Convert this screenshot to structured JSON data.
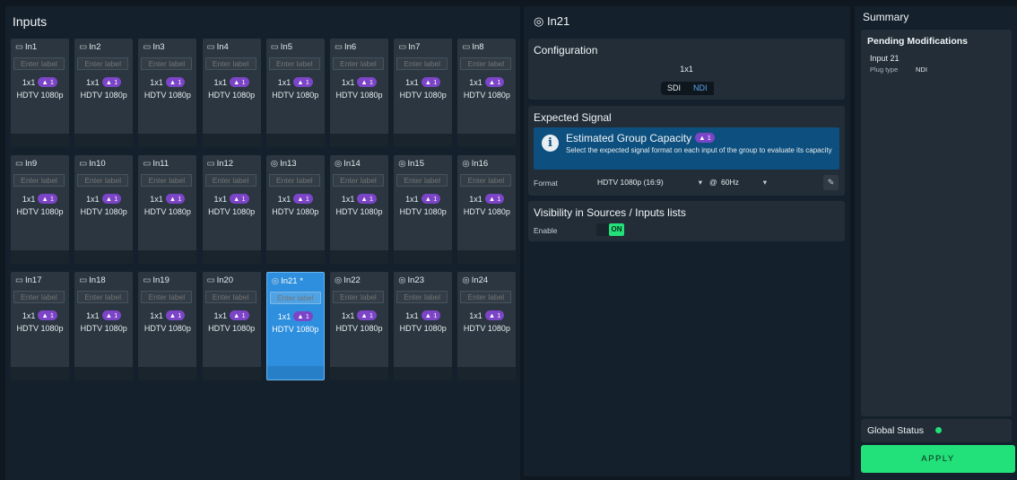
{
  "inputs_panel": {
    "title": "Inputs",
    "label_placeholder": "Enter label",
    "cards": [
      {
        "name": "In1",
        "format": "1x1",
        "badge": "▲ 1",
        "resolution": "HDTV 1080p",
        "icon": "sdi-plug-icon",
        "selected": false
      },
      {
        "name": "In2",
        "format": "1x1",
        "badge": "▲ 1",
        "resolution": "HDTV 1080p",
        "icon": "sdi-plug-icon",
        "selected": false
      },
      {
        "name": "In3",
        "format": "1x1",
        "badge": "▲ 1",
        "resolution": "HDTV 1080p",
        "icon": "sdi-plug-icon",
        "selected": false
      },
      {
        "name": "In4",
        "format": "1x1",
        "badge": "▲ 1",
        "resolution": "HDTV 1080p",
        "icon": "sdi-plug-icon",
        "selected": false
      },
      {
        "name": "In5",
        "format": "1x1",
        "badge": "▲ 1",
        "resolution": "HDTV 1080p",
        "icon": "sdi-plug-icon",
        "selected": false
      },
      {
        "name": "In6",
        "format": "1x1",
        "badge": "▲ 1",
        "resolution": "HDTV 1080p",
        "icon": "sdi-plug-icon",
        "selected": false
      },
      {
        "name": "In7",
        "format": "1x1",
        "badge": "▲ 1",
        "resolution": "HDTV 1080p",
        "icon": "sdi-plug-icon",
        "selected": false
      },
      {
        "name": "In8",
        "format": "1x1",
        "badge": "▲ 1",
        "resolution": "HDTV 1080p",
        "icon": "sdi-plug-icon",
        "selected": false
      },
      {
        "name": "In9",
        "format": "1x1",
        "badge": "▲ 1",
        "resolution": "HDTV 1080p",
        "icon": "sdi-plug-icon",
        "selected": false
      },
      {
        "name": "In10",
        "format": "1x1",
        "badge": "▲ 1",
        "resolution": "HDTV 1080p",
        "icon": "sdi-plug-icon",
        "selected": false
      },
      {
        "name": "In11",
        "format": "1x1",
        "badge": "▲ 1",
        "resolution": "HDTV 1080p",
        "icon": "sdi-plug-icon",
        "selected": false
      },
      {
        "name": "In12",
        "format": "1x1",
        "badge": "▲ 1",
        "resolution": "HDTV 1080p",
        "icon": "sdi-plug-icon",
        "selected": false
      },
      {
        "name": "In13",
        "format": "1x1",
        "badge": "▲ 1",
        "resolution": "HDTV 1080p",
        "icon": "ndi-icon",
        "selected": false
      },
      {
        "name": "In14",
        "format": "1x1",
        "badge": "▲ 1",
        "resolution": "HDTV 1080p",
        "icon": "ndi-icon",
        "selected": false
      },
      {
        "name": "In15",
        "format": "1x1",
        "badge": "▲ 1",
        "resolution": "HDTV 1080p",
        "icon": "ndi-icon",
        "selected": false
      },
      {
        "name": "In16",
        "format": "1x1",
        "badge": "▲ 1",
        "resolution": "HDTV 1080p",
        "icon": "ndi-icon",
        "selected": false
      },
      {
        "name": "In17",
        "format": "1x1",
        "badge": "▲ 1",
        "resolution": "HDTV 1080p",
        "icon": "sdi-plug-icon",
        "selected": false
      },
      {
        "name": "In18",
        "format": "1x1",
        "badge": "▲ 1",
        "resolution": "HDTV 1080p",
        "icon": "sdi-plug-icon",
        "selected": false
      },
      {
        "name": "In19",
        "format": "1x1",
        "badge": "▲ 1",
        "resolution": "HDTV 1080p",
        "icon": "sdi-plug-icon",
        "selected": false
      },
      {
        "name": "In20",
        "format": "1x1",
        "badge": "▲ 1",
        "resolution": "HDTV 1080p",
        "icon": "sdi-plug-icon",
        "selected": false
      },
      {
        "name": "In21 *",
        "format": "1x1",
        "badge": "▲ 1",
        "resolution": "HDTV 1080p",
        "icon": "ndi-icon",
        "selected": true
      },
      {
        "name": "In22",
        "format": "1x1",
        "badge": "▲ 1",
        "resolution": "HDTV 1080p",
        "icon": "ndi-icon",
        "selected": false
      },
      {
        "name": "In23",
        "format": "1x1",
        "badge": "▲ 1",
        "resolution": "HDTV 1080p",
        "icon": "ndi-icon",
        "selected": false
      },
      {
        "name": "In24",
        "format": "1x1",
        "badge": "▲ 1",
        "resolution": "HDTV 1080p",
        "icon": "ndi-icon",
        "selected": false
      }
    ]
  },
  "detail": {
    "title": "In21",
    "title_icon": "ndi-icon",
    "configuration": {
      "title": "Configuration",
      "value": "1x1",
      "options": [
        "SDI",
        "NDI"
      ],
      "selected": "NDI"
    },
    "expected_signal": {
      "title": "Expected Signal",
      "info_title": "Estimated Group Capacity",
      "info_badge": "▲ 1",
      "info_text": "Select the expected signal format on each input of the group to evaluate its capacity",
      "format_label": "Format",
      "format_value": "HDTV 1080p (16:9)",
      "at_label": "@",
      "rate_value": "60Hz"
    },
    "visibility": {
      "title": "Visibility in Sources / Inputs lists",
      "enable_label": "Enable",
      "toggle_state": "ON"
    }
  },
  "summary": {
    "title": "Summary",
    "pending_title": "Pending Modifications",
    "pending_input": "Input 21",
    "plug_type_label": "Plug type",
    "plug_type_value": "NDI",
    "global_status_label": "Global Status",
    "apply_label": "APPLY"
  },
  "colors": {
    "background": "#0f1820",
    "panel": "#14202b",
    "card": "#2b3640",
    "selected_card": "#2e8fde",
    "badge": "#7c45c8",
    "accent_green": "#22e07a",
    "info_blue": "#0d4f7e"
  }
}
